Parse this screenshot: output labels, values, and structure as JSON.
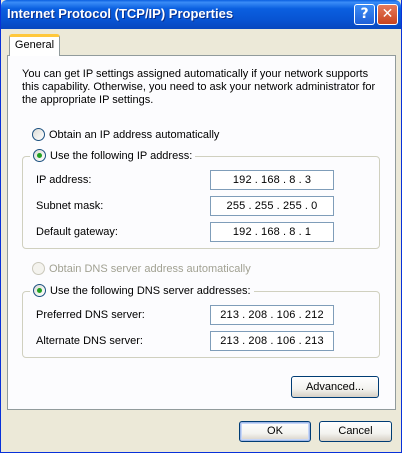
{
  "window": {
    "title": "Internet Protocol (TCP/IP) Properties",
    "help_glyph": "?",
    "close_glyph": "✕"
  },
  "tabs": [
    {
      "label": "General"
    }
  ],
  "intro_text": "You can get IP settings assigned automatically if your network supports this capability. Otherwise, you need to ask your network administrator for the appropriate IP settings.",
  "ip": {
    "auto_label": "Obtain an IP address automatically",
    "manual_label": "Use the following IP address:",
    "selected": "manual",
    "fields": [
      {
        "label": "IP address:",
        "octets": [
          "192",
          "168",
          "8",
          "3"
        ]
      },
      {
        "label": "Subnet mask:",
        "octets": [
          "255",
          "255",
          "255",
          "0"
        ]
      },
      {
        "label": "Default gateway:",
        "octets": [
          "192",
          "168",
          "8",
          "1"
        ]
      }
    ]
  },
  "dns": {
    "auto_label": "Obtain DNS server address automatically",
    "manual_label": "Use the following DNS server addresses:",
    "selected": "manual",
    "auto_disabled": true,
    "fields": [
      {
        "label": "Preferred DNS server:",
        "octets": [
          "213",
          "208",
          "106",
          "212"
        ]
      },
      {
        "label": "Alternate DNS server:",
        "octets": [
          "213",
          "208",
          "106",
          "213"
        ]
      }
    ]
  },
  "buttons": {
    "advanced": "Advanced...",
    "ok": "OK",
    "cancel": "Cancel"
  },
  "colors": {
    "titlebar": "#0A5FE0",
    "dialog_bg": "#ECE9D8",
    "tab_accent": "#FFC83C",
    "radio_dot": "#21A121"
  }
}
